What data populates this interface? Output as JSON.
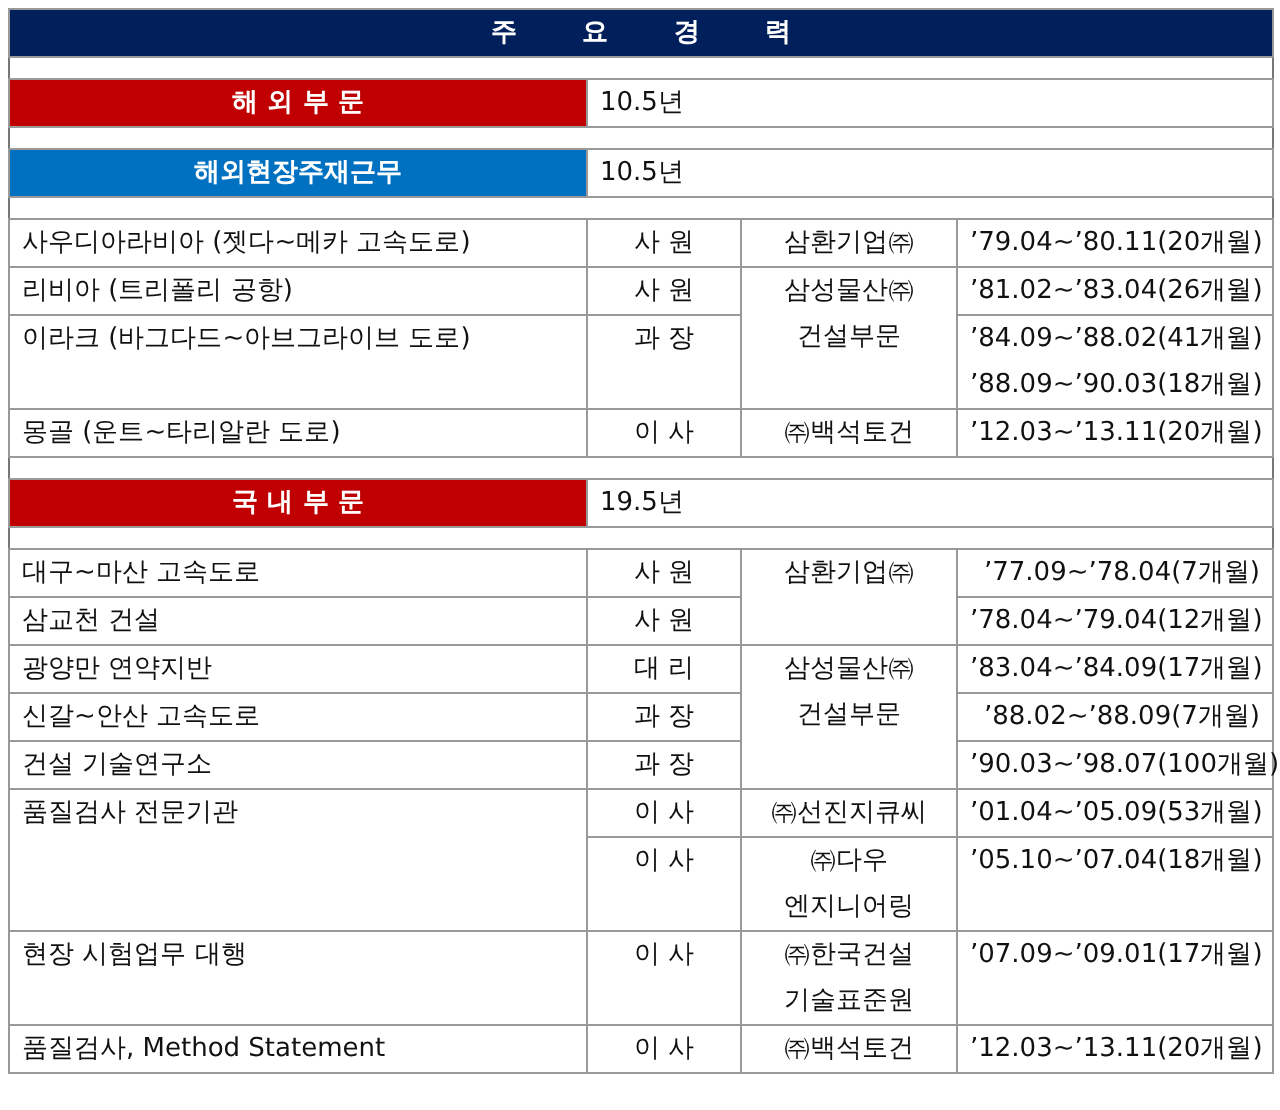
{
  "title": "주 요 경 력",
  "sections": [
    {
      "headers": [
        {
          "label": "해 외 부 문",
          "value": "10.5년",
          "color": "#c00000"
        },
        {
          "label": "해외현장주재근무",
          "value": "10.5년",
          "color": "#0070c0"
        }
      ],
      "rows": [
        {
          "project": [
            "사우디아라비아 (젯다~메카 고속도로)"
          ],
          "position": [
            "사 원"
          ],
          "company": [
            "삼환기업㈜"
          ],
          "period": [
            "’79.04~’80.11(20개월)"
          ]
        },
        {
          "project": [
            "리비아 (트리폴리 공항)"
          ],
          "position": [
            "사 원"
          ],
          "company": [
            "삼성물산㈜",
            "건설부문"
          ],
          "period": [
            "’81.02~’83.04(26개월)"
          ]
        },
        {
          "project": [
            "이라크 (바그다드~아브그라이브 도로)"
          ],
          "position": [
            "과 장"
          ],
          "period": [
            "’84.09~’88.02(41개월)",
            "’88.09~’90.03(18개월)"
          ]
        },
        {
          "project": [
            "몽골 (운트~타리알란 도로)"
          ],
          "position": [
            "이 사"
          ],
          "company": [
            "㈜백석토건"
          ],
          "period": [
            "’12.03~’13.11(20개월)"
          ]
        }
      ]
    },
    {
      "headers": [
        {
          "label": "국 내 부 문",
          "value": "19.5년",
          "color": "#c00000"
        }
      ],
      "rows": [
        {
          "project": [
            "대구~마산 고속도로"
          ],
          "position": [
            "사 원"
          ],
          "company": [
            "삼환기업㈜"
          ],
          "period": [
            "’77.09~’78.04(7개월)"
          ]
        },
        {
          "project": [
            "삼교천 건설"
          ],
          "position": [
            "사 원"
          ],
          "period": [
            "’78.04~’79.04(12개월)"
          ]
        },
        {
          "project": [
            "광양만 연약지반"
          ],
          "position": [
            "대 리"
          ],
          "company": [
            "삼성물산㈜",
            "건설부문"
          ],
          "period": [
            "’83.04~’84.09(17개월)"
          ]
        },
        {
          "project": [
            "신갈~안산 고속도로"
          ],
          "position": [
            "과 장"
          ],
          "period": [
            "’88.02~’88.09(7개월)"
          ]
        },
        {
          "project": [
            "건설 기술연구소"
          ],
          "position": [
            "과 장"
          ],
          "period": [
            "’90.03~’98.07(100개월)"
          ]
        },
        {
          "project": [
            "품질검사 전문기관"
          ],
          "position": [
            "이 사"
          ],
          "company": [
            "㈜선진지큐씨"
          ],
          "period": [
            "’01.04~’05.09(53개월)"
          ]
        },
        {
          "position": [
            "이 사"
          ],
          "company": [
            "㈜다우",
            "엔지니어링"
          ],
          "period": [
            "’05.10~’07.04(18개월)"
          ]
        },
        {
          "project": [
            "현장 시험업무 대행"
          ],
          "position": [
            "이 사"
          ],
          "company": [
            "㈜한국건설",
            "기술표준원"
          ],
          "period": [
            "’07.09~’09.01(17개월)"
          ]
        },
        {
          "project": [
            "품질검사, Method Statement"
          ],
          "position": [
            "이 사"
          ],
          "company": [
            "㈜백석토건"
          ],
          "period": [
            "’12.03~’13.11(20개월)"
          ]
        }
      ]
    }
  ]
}
